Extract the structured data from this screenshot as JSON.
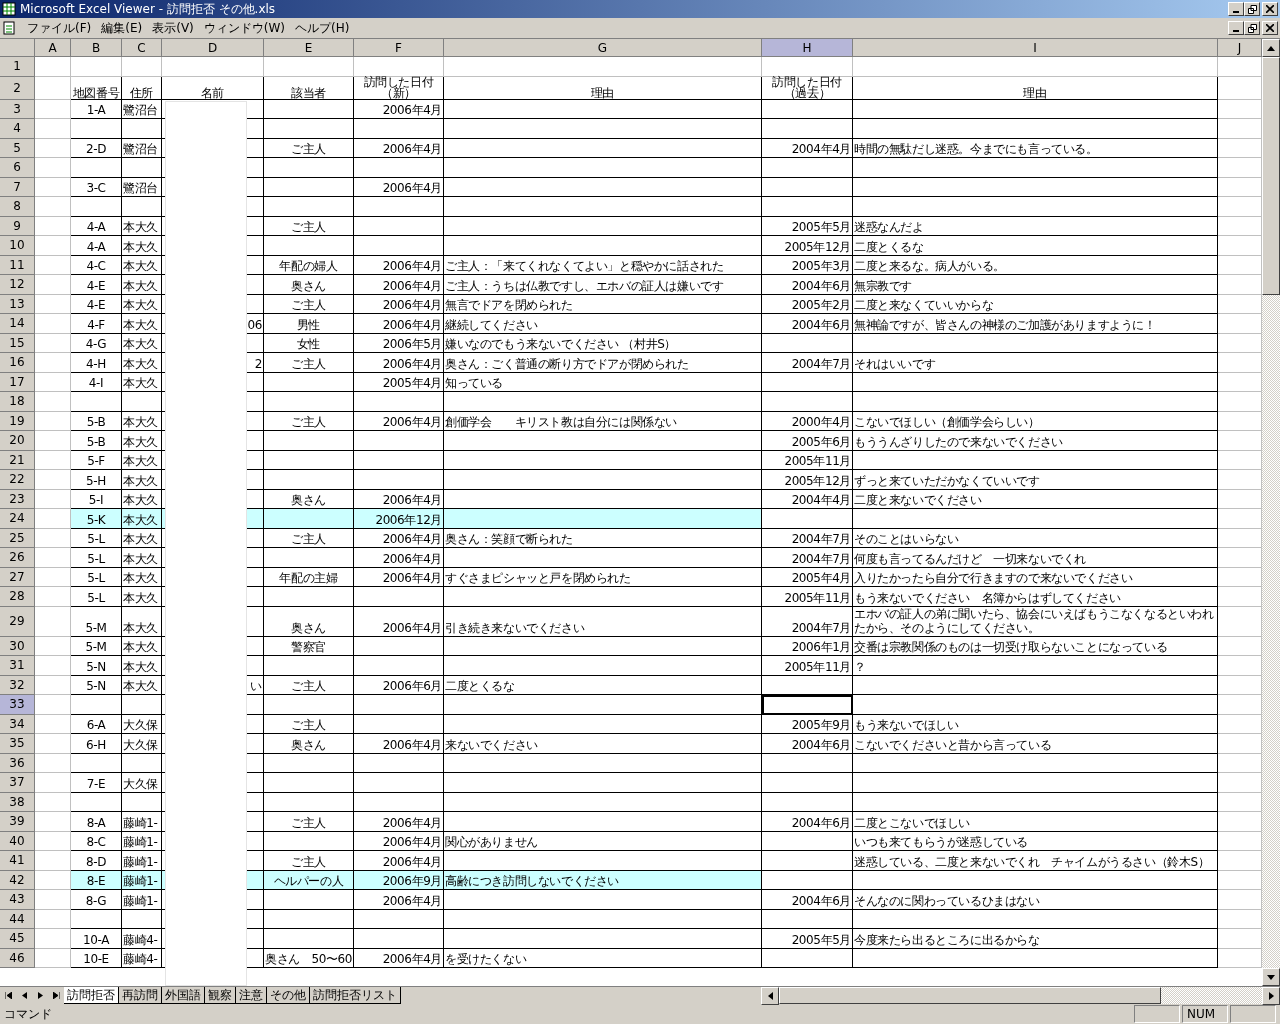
{
  "window": {
    "title": "Microsoft Excel Viewer - 訪問拒否  その他.xls"
  },
  "menu": [
    "ファイル(F)",
    "編集(E)",
    "表示(V)",
    "ウィンドウ(W)",
    "ヘルプ(H)"
  ],
  "columns": [
    {
      "label": "A",
      "selected": false
    },
    {
      "label": "B",
      "selected": false
    },
    {
      "label": "C",
      "selected": false
    },
    {
      "label": "D",
      "selected": false
    },
    {
      "label": "E",
      "selected": false
    },
    {
      "label": "F",
      "selected": false
    },
    {
      "label": "G",
      "selected": false
    },
    {
      "label": "H",
      "selected": true
    },
    {
      "label": "I",
      "selected": false
    },
    {
      "label": "J",
      "selected": false
    }
  ],
  "rows": [
    {
      "number": "1",
      "kind": "blank",
      "selected": false,
      "highlighted": false,
      "cells": {}
    },
    {
      "number": "2",
      "kind": "heading",
      "selected": false,
      "highlighted": false,
      "cells": {
        "B": "地図番号",
        "C": "住所",
        "D": "名前",
        "E": "該当者",
        "F": "訪問した日付（新）",
        "G": "理由",
        "H": "訪問した日付（過去）",
        "I": "理由"
      }
    },
    {
      "number": "3",
      "kind": "data",
      "selected": false,
      "highlighted": false,
      "cells": {
        "B": "1-A",
        "C": "鷺沼台",
        "F": "2006年4月"
      }
    },
    {
      "number": "4",
      "kind": "data",
      "selected": false,
      "highlighted": false,
      "cells": {}
    },
    {
      "number": "5",
      "kind": "data",
      "selected": false,
      "highlighted": false,
      "cells": {
        "B": "2-D",
        "C": "鷺沼台",
        "E": "ご主人",
        "F": "2006年4月",
        "H": "2004年4月",
        "I": "時間の無駄だし迷惑。今までにも言っている。"
      }
    },
    {
      "number": "6",
      "kind": "data",
      "selected": false,
      "highlighted": false,
      "cells": {}
    },
    {
      "number": "7",
      "kind": "data",
      "selected": false,
      "highlighted": false,
      "cells": {
        "B": "3-C",
        "C": "鷺沼台",
        "F": "2006年4月"
      }
    },
    {
      "number": "8",
      "kind": "data",
      "selected": false,
      "highlighted": false,
      "cells": {}
    },
    {
      "number": "9",
      "kind": "data",
      "selected": false,
      "highlighted": false,
      "cells": {
        "B": "4-A",
        "C": "本大久",
        "E": "ご主人",
        "H": "2005年5月",
        "I": "迷惑なんだよ"
      }
    },
    {
      "number": "10",
      "kind": "data",
      "selected": false,
      "highlighted": false,
      "cells": {
        "B": "4-A",
        "C": "本大久",
        "H": "2005年12月",
        "I": "二度とくるな"
      }
    },
    {
      "number": "11",
      "kind": "data",
      "selected": false,
      "highlighted": false,
      "cells": {
        "B": "4-C",
        "C": "本大久",
        "E": "年配の婦人",
        "F": "2006年4月",
        "G": "ご主人：「来てくれなくてよい」と穏やかに話された",
        "H": "2005年3月",
        "I": "二度と来るな。病人がいる。"
      }
    },
    {
      "number": "12",
      "kind": "data",
      "selected": false,
      "highlighted": false,
      "cells": {
        "B": "4-E",
        "C": "本大久",
        "E": "奥さん",
        "F": "2006年4月",
        "G": "ご主人：うちは仏教ですし、エホバの証人は嫌いです",
        "H": "2004年6月",
        "I": "無宗教です"
      }
    },
    {
      "number": "13",
      "kind": "data",
      "selected": false,
      "highlighted": false,
      "cells": {
        "B": "4-E",
        "C": "本大久",
        "E": "ご主人",
        "F": "2006年4月",
        "G": "無言でドアを閉められた",
        "H": "2005年2月",
        "I": "二度と来なくていいからな"
      }
    },
    {
      "number": "14",
      "kind": "data",
      "selected": false,
      "highlighted": false,
      "cells": {
        "B": "4-F",
        "C": "本大久",
        "D": "06",
        "E": "男性",
        "F": "2006年4月",
        "G": "継続してください",
        "H": "2004年6月",
        "I": "無神論ですが、皆さんの神様のご加護がありますように！"
      }
    },
    {
      "number": "15",
      "kind": "data",
      "selected": false,
      "highlighted": false,
      "cells": {
        "B": "4-G",
        "C": "本大久",
        "E": "女性",
        "F": "2006年5月",
        "G": "嫌いなのでもう来ないでください （村井S）"
      }
    },
    {
      "number": "16",
      "kind": "data",
      "selected": false,
      "highlighted": false,
      "cells": {
        "B": "4-H",
        "C": "本大久",
        "D": "2",
        "E": "ご主人",
        "F": "2006年4月",
        "G": "奥さん：ごく普通の断り方でドアが閉められた",
        "H": "2004年7月",
        "I": "それはいいです"
      }
    },
    {
      "number": "17",
      "kind": "data",
      "selected": false,
      "highlighted": false,
      "cells": {
        "B": "4-I",
        "C": "本大久",
        "F": "2005年4月",
        "G": "知っている"
      }
    },
    {
      "number": "18",
      "kind": "data",
      "selected": false,
      "highlighted": false,
      "cells": {}
    },
    {
      "number": "19",
      "kind": "data",
      "selected": false,
      "highlighted": false,
      "cells": {
        "B": "5-B",
        "C": "本大久",
        "E": "ご主人",
        "F": "2006年4月",
        "G": "創価学会　　キリスト教は自分には関係ない",
        "H": "2000年4月",
        "I": "こないでほしい（創価学会らしい）"
      }
    },
    {
      "number": "20",
      "kind": "data",
      "selected": false,
      "highlighted": false,
      "cells": {
        "B": "5-B",
        "C": "本大久",
        "H": "2005年6月",
        "I": "もううんざりしたので来ないでください"
      }
    },
    {
      "number": "21",
      "kind": "data",
      "selected": false,
      "highlighted": false,
      "cells": {
        "B": "5-F",
        "C": "本大久",
        "H": "2005年11月"
      }
    },
    {
      "number": "22",
      "kind": "data",
      "selected": false,
      "highlighted": false,
      "cells": {
        "B": "5-H",
        "C": "本大久",
        "H": "2005年12月",
        "I": "ずっと来ていただかなくていいです"
      }
    },
    {
      "number": "23",
      "kind": "data",
      "selected": false,
      "highlighted": false,
      "cells": {
        "B": "5-I",
        "C": "本大久",
        "E": "奥さん",
        "F": "2006年4月",
        "H": "2004年4月",
        "I": "二度と来ないでください"
      }
    },
    {
      "number": "24",
      "kind": "data",
      "selected": false,
      "highlighted": true,
      "cells": {
        "B": "5-K",
        "C": "本大久",
        "F": "2006年12月"
      }
    },
    {
      "number": "25",
      "kind": "data",
      "selected": false,
      "highlighted": false,
      "cells": {
        "B": "5-L",
        "C": "本大久",
        "E": "ご主人",
        "F": "2006年4月",
        "G": "奥さん：笑顔で断られた",
        "H": "2004年7月",
        "I": "そのことはいらない"
      }
    },
    {
      "number": "26",
      "kind": "data",
      "selected": false,
      "highlighted": false,
      "cells": {
        "B": "5-L",
        "C": "本大久",
        "F": "2006年4月",
        "H": "2004年7月",
        "I": "何度も言ってるんだけど　一切来ないでくれ"
      }
    },
    {
      "number": "27",
      "kind": "data",
      "selected": false,
      "highlighted": false,
      "cells": {
        "B": "5-L",
        "C": "本大久",
        "E": "年配の主婦",
        "F": "2006年4月",
        "G": "すぐさまピシャッと戸を閉められた",
        "H": "2005年4月",
        "I": "入りたかったら自分で行きますので来ないでください"
      }
    },
    {
      "number": "28",
      "kind": "data",
      "selected": false,
      "highlighted": false,
      "cells": {
        "B": "5-L",
        "C": "本大久",
        "H": "2005年11月",
        "I": "もう来ないでください　名簿からはずしてください"
      }
    },
    {
      "number": "29",
      "kind": "data",
      "selected": false,
      "highlighted": false,
      "cells": {
        "B": "5-M",
        "C": "本大久",
        "E": "奥さん",
        "F": "2006年4月",
        "G": "引き続き来ないでください",
        "H": "2004年7月",
        "I": "エホバの証人の弟に聞いたら、協会にいえばもうこなくなるといわれたから、そのようにしてください。"
      }
    },
    {
      "number": "30",
      "kind": "data",
      "selected": false,
      "highlighted": false,
      "cells": {
        "B": "5-M",
        "C": "本大久",
        "E": "警察官",
        "H": "2006年1月",
        "I": "交番は宗教関係のものは一切受け取らないことになっている"
      }
    },
    {
      "number": "31",
      "kind": "data",
      "selected": false,
      "highlighted": false,
      "cells": {
        "B": "5-N",
        "C": "本大久",
        "H": "2005年11月",
        "I": "？"
      }
    },
    {
      "number": "32",
      "kind": "data",
      "selected": false,
      "highlighted": false,
      "cells": {
        "B": "5-N",
        "C": "本大久",
        "D": "い",
        "E": "ご主人",
        "F": "2006年6月",
        "G": "二度とくるな"
      }
    },
    {
      "number": "33",
      "kind": "data",
      "selected": true,
      "highlighted": false,
      "cells": {}
    },
    {
      "number": "34",
      "kind": "data",
      "selected": false,
      "highlighted": false,
      "cells": {
        "B": "6-A",
        "C": "大久保",
        "E": "ご主人",
        "H": "2005年9月",
        "I": "もう来ないでほしい"
      }
    },
    {
      "number": "35",
      "kind": "data",
      "selected": false,
      "highlighted": false,
      "cells": {
        "B": "6-H",
        "C": "大久保",
        "E": "奥さん",
        "F": "2006年4月",
        "G": "来ないでください",
        "H": "2004年6月",
        "I": "こないでくださいと昔から言っている"
      }
    },
    {
      "number": "36",
      "kind": "data",
      "selected": false,
      "highlighted": false,
      "cells": {}
    },
    {
      "number": "37",
      "kind": "data",
      "selected": false,
      "highlighted": false,
      "cells": {
        "B": "7-E",
        "C": "大久保"
      }
    },
    {
      "number": "38",
      "kind": "data",
      "selected": false,
      "highlighted": false,
      "cells": {}
    },
    {
      "number": "39",
      "kind": "data",
      "selected": false,
      "highlighted": false,
      "cells": {
        "B": "8-A",
        "C": "藤崎1-",
        "E": "ご主人",
        "F": "2006年4月",
        "H": "2004年6月",
        "I": "二度とこないでほしい"
      }
    },
    {
      "number": "40",
      "kind": "data",
      "selected": false,
      "highlighted": false,
      "cells": {
        "B": "8-C",
        "C": "藤崎1-",
        "F": "2006年4月",
        "G": "関心がありません",
        "I": "いつも来てもらうが迷惑している"
      }
    },
    {
      "number": "41",
      "kind": "data",
      "selected": false,
      "highlighted": false,
      "cells": {
        "B": "8-D",
        "C": "藤崎1-",
        "E": "ご主人",
        "F": "2006年4月",
        "I": "迷惑している、二度と来ないでくれ　チャイムがうるさい（鈴木S）"
      }
    },
    {
      "number": "42",
      "kind": "data",
      "selected": false,
      "highlighted": true,
      "cells": {
        "B": "8-E",
        "C": "藤崎1-",
        "E": "ヘルパーの人",
        "F": "2006年9月",
        "G": "高齢につき訪問しないでください"
      }
    },
    {
      "number": "43",
      "kind": "data",
      "selected": false,
      "highlighted": false,
      "cells": {
        "B": "8-G",
        "C": "藤崎1-",
        "F": "2006年4月",
        "H": "2004年6月",
        "I": "そんなのに関わっているひまはない"
      }
    },
    {
      "number": "44",
      "kind": "data",
      "selected": false,
      "highlighted": false,
      "cells": {}
    },
    {
      "number": "45",
      "kind": "data",
      "selected": false,
      "highlighted": false,
      "cells": {
        "B": "10-A",
        "C": "藤崎4-",
        "H": "2005年5月",
        "I": "今度来たら出るところに出るからな"
      }
    },
    {
      "number": "46",
      "kind": "data",
      "selected": false,
      "highlighted": false,
      "cells": {
        "B": "10-E",
        "C": "藤崎4-",
        "E": "奥さん　50〜60",
        "F": "2006年4月",
        "G": "を受けたくない"
      }
    }
  ],
  "sheet_tabs": [
    {
      "label": "訪問拒否",
      "selected": true
    },
    {
      "label": "再訪問",
      "selected": false
    },
    {
      "label": "外国語",
      "selected": false
    },
    {
      "label": "観察",
      "selected": false
    },
    {
      "label": "注意",
      "selected": false
    },
    {
      "label": "その他",
      "selected": false
    },
    {
      "label": "訪問拒否リスト",
      "selected": false
    }
  ],
  "status_bar": {
    "mode": "コマンド",
    "indicator": "NUM"
  }
}
